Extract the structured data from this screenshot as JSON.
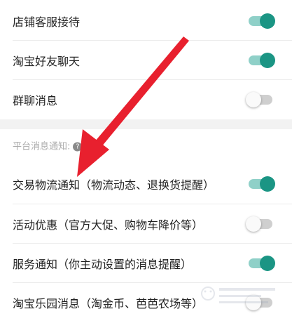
{
  "settings": {
    "items": [
      {
        "label": "店铺客服接待",
        "enabled": true
      },
      {
        "label": "淘宝好友聊天",
        "enabled": true
      },
      {
        "label": "群聊消息",
        "enabled": false
      }
    ]
  },
  "platform_section": {
    "title": "平台消息通知:",
    "help_icon": "help-icon",
    "items": [
      {
        "label": "交易物流通知（物流动态、退换货提醒）",
        "enabled": true
      },
      {
        "label": "活动优惠（官方大促、购物车降价等）",
        "enabled": false
      },
      {
        "label": "服务通知（你主动设置的消息提醒）",
        "enabled": true
      },
      {
        "label": "淘宝乐园消息（淘金币、芭芭农场等）",
        "enabled": false
      }
    ]
  },
  "colors": {
    "toggle_on_track": "#8fd0c8",
    "toggle_on_knob": "#1b9584",
    "toggle_off_track": "#cfcfcf",
    "arrow": "#e8202e"
  }
}
